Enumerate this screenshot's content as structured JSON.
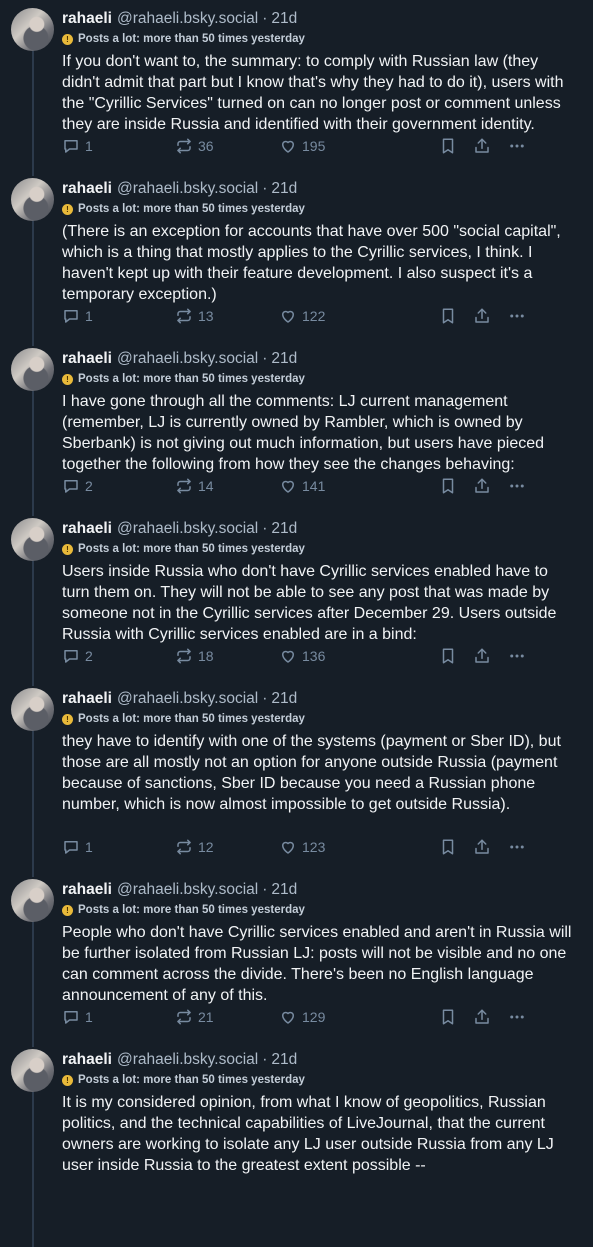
{
  "posts": [
    {
      "name": "rahaeli",
      "handle": "@rahaeli.bsky.social",
      "age": "21d",
      "badge": "Posts a lot: more than 50 times yesterday",
      "text": "If you don't want to, the summary: to comply with Russian law (they didn't admit that part but I know that's why they had to do it), users with the \"Cyrillic Services\" turned on can no longer post or comment unless they are inside Russia and identified with their government identity.",
      "replies": "1",
      "reposts": "36",
      "likes": "195"
    },
    {
      "name": "rahaeli",
      "handle": "@rahaeli.bsky.social",
      "age": "21d",
      "badge": "Posts a lot: more than 50 times yesterday",
      "text": "(There is an exception for accounts that have over 500 \"social capital\", which is a thing that mostly applies to the Cyrillic services, I think. I haven't kept up with their feature development. I also suspect it's a temporary exception.)",
      "replies": "1",
      "reposts": "13",
      "likes": "122"
    },
    {
      "name": "rahaeli",
      "handle": "@rahaeli.bsky.social",
      "age": "21d",
      "badge": "Posts a lot: more than 50 times yesterday",
      "text": "I have gone through all the comments: LJ current management (remember, LJ is currently owned by Rambler, which is owned by Sberbank) is not giving out much information, but users have pieced together the following from how they see the changes behaving:",
      "replies": "2",
      "reposts": "14",
      "likes": "141"
    },
    {
      "name": "rahaeli",
      "handle": "@rahaeli.bsky.social",
      "age": "21d",
      "badge": "Posts a lot: more than 50 times yesterday",
      "text": "Users inside Russia who don't have Cyrillic services enabled have to turn them on. They will not be able to see any post that was made by someone not in the Cyrillic services after December 29. Users outside Russia with Cyrillic services enabled are in a bind:",
      "replies": "2",
      "reposts": "18",
      "likes": "136"
    },
    {
      "name": "rahaeli",
      "handle": "@rahaeli.bsky.social",
      "age": "21d",
      "badge": "Posts a lot: more than 50 times yesterday",
      "text": "they have to identify with one of the systems (payment or Sber ID), but those are all mostly not an option for anyone outside Russia (payment because of sanctions, Sber ID because you need a Russian phone number, which is now almost impossible to get outside Russia).",
      "replies": "1",
      "reposts": "12",
      "likes": "123"
    },
    {
      "name": "rahaeli",
      "handle": "@rahaeli.bsky.social",
      "age": "21d",
      "badge": "Posts a lot: more than 50 times yesterday",
      "text": "People who don't have Cyrillic services enabled and aren't in Russia will be further isolated from Russian LJ: posts will not be visible and no one can comment across the divide. There's been no English language announcement of any of this.",
      "replies": "1",
      "reposts": "21",
      "likes": "129"
    },
    {
      "name": "rahaeli",
      "handle": "@rahaeli.bsky.social",
      "age": "21d",
      "badge": "Posts a lot: more than 50 times yesterday",
      "text": "It is my considered opinion, from what I know of geopolitics, Russian politics, and the technical capabilities of LiveJournal, that the current owners are working to isolate any LJ user outside Russia from any LJ user inside Russia to the greatest extent possible --",
      "replies": "",
      "reposts": "",
      "likes": ""
    }
  ]
}
